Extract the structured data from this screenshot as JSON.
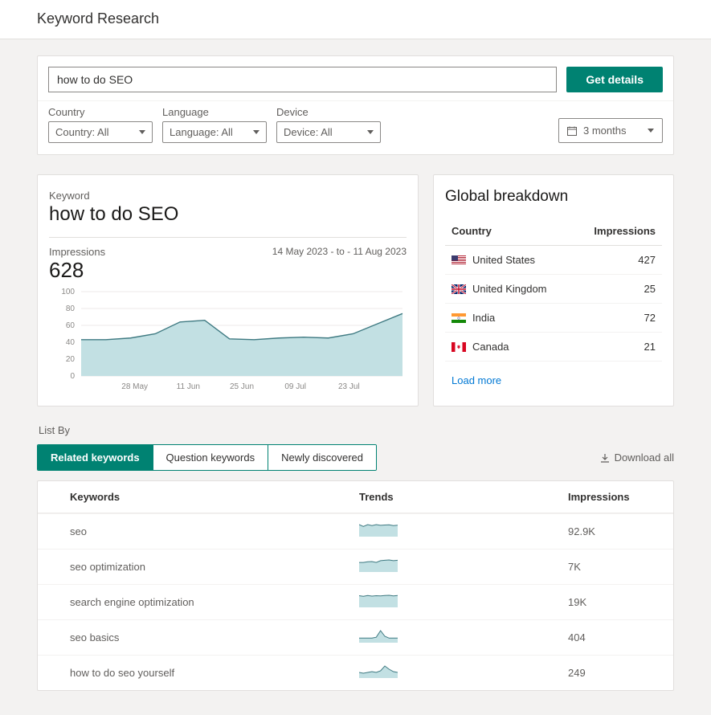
{
  "page_title": "Keyword Research",
  "search": {
    "value": "how to do SEO",
    "button": "Get details"
  },
  "filters": {
    "country": {
      "label": "Country",
      "value": "Country: All"
    },
    "language": {
      "label": "Language",
      "value": "Language: All"
    },
    "device": {
      "label": "Device",
      "value": "Device: All"
    },
    "date_range_value": "3 months"
  },
  "keyword_card": {
    "label": "Keyword",
    "value": "how to do SEO",
    "impressions_label": "Impressions",
    "impressions_value": "628",
    "date_range_text": "14 May 2023 - to - 11 Aug 2023"
  },
  "chart_data": {
    "type": "area",
    "title": "Impressions",
    "xlabel": "",
    "ylabel": "",
    "ylim": [
      0,
      100
    ],
    "y_ticks": [
      0,
      20,
      40,
      60,
      80,
      100
    ],
    "x_tick_labels": [
      "28 May",
      "11 Jun",
      "25 Jun",
      "09 Jul",
      "23 Jul"
    ],
    "x": [
      "14 May",
      "21 May",
      "28 May",
      "04 Jun",
      "11 Jun",
      "18 Jun",
      "25 Jun",
      "02 Jul",
      "09 Jul",
      "16 Jul",
      "23 Jul",
      "30 Jul",
      "06 Aug",
      "11 Aug"
    ],
    "values": [
      43,
      43,
      45,
      50,
      64,
      66,
      44,
      43,
      45,
      46,
      45,
      50,
      62,
      74
    ],
    "fill_color": "#c2e0e3",
    "line_color": "#3f7a82"
  },
  "breakdown": {
    "title": "Global breakdown",
    "col1": "Country",
    "col2": "Impressions",
    "rows": [
      {
        "country": "United States",
        "flag": "us",
        "impressions": "427"
      },
      {
        "country": "United Kingdom",
        "flag": "gb",
        "impressions": "25"
      },
      {
        "country": "India",
        "flag": "in",
        "impressions": "72"
      },
      {
        "country": "Canada",
        "flag": "ca",
        "impressions": "21"
      }
    ],
    "load_more": "Load more"
  },
  "list_by": {
    "label": "List By",
    "tabs": [
      "Related keywords",
      "Question keywords",
      "Newly discovered"
    ],
    "active_tab": 0,
    "download_label": "Download all"
  },
  "results": {
    "col_keywords": "Keywords",
    "col_trends": "Trends",
    "col_impressions": "Impressions",
    "rows": [
      {
        "keyword": "seo",
        "impressions": "92.9K",
        "spark": [
          6,
          5,
          6,
          5.5,
          6,
          5.6,
          5.8,
          5.9,
          5.5,
          5.7
        ]
      },
      {
        "keyword": "seo optimization",
        "impressions": "7K",
        "spark": [
          5,
          5,
          5.4,
          5.5,
          5,
          6,
          6.2,
          6.4,
          6,
          6.2
        ]
      },
      {
        "keyword": "search engine optimization",
        "impressions": "19K",
        "spark": [
          5.5,
          5.2,
          5.6,
          5.3,
          5.5,
          5.4,
          5.6,
          5.7,
          5.4,
          5.6
        ]
      },
      {
        "keyword": "seo basics",
        "impressions": "404",
        "spark": [
          2,
          2,
          2,
          2,
          2.5,
          6,
          3,
          2,
          2,
          2
        ]
      },
      {
        "keyword": "how to do seo yourself",
        "impressions": "249",
        "spark": [
          3,
          2.5,
          3,
          3.5,
          3,
          4,
          7,
          5,
          3.5,
          3
        ]
      }
    ]
  }
}
